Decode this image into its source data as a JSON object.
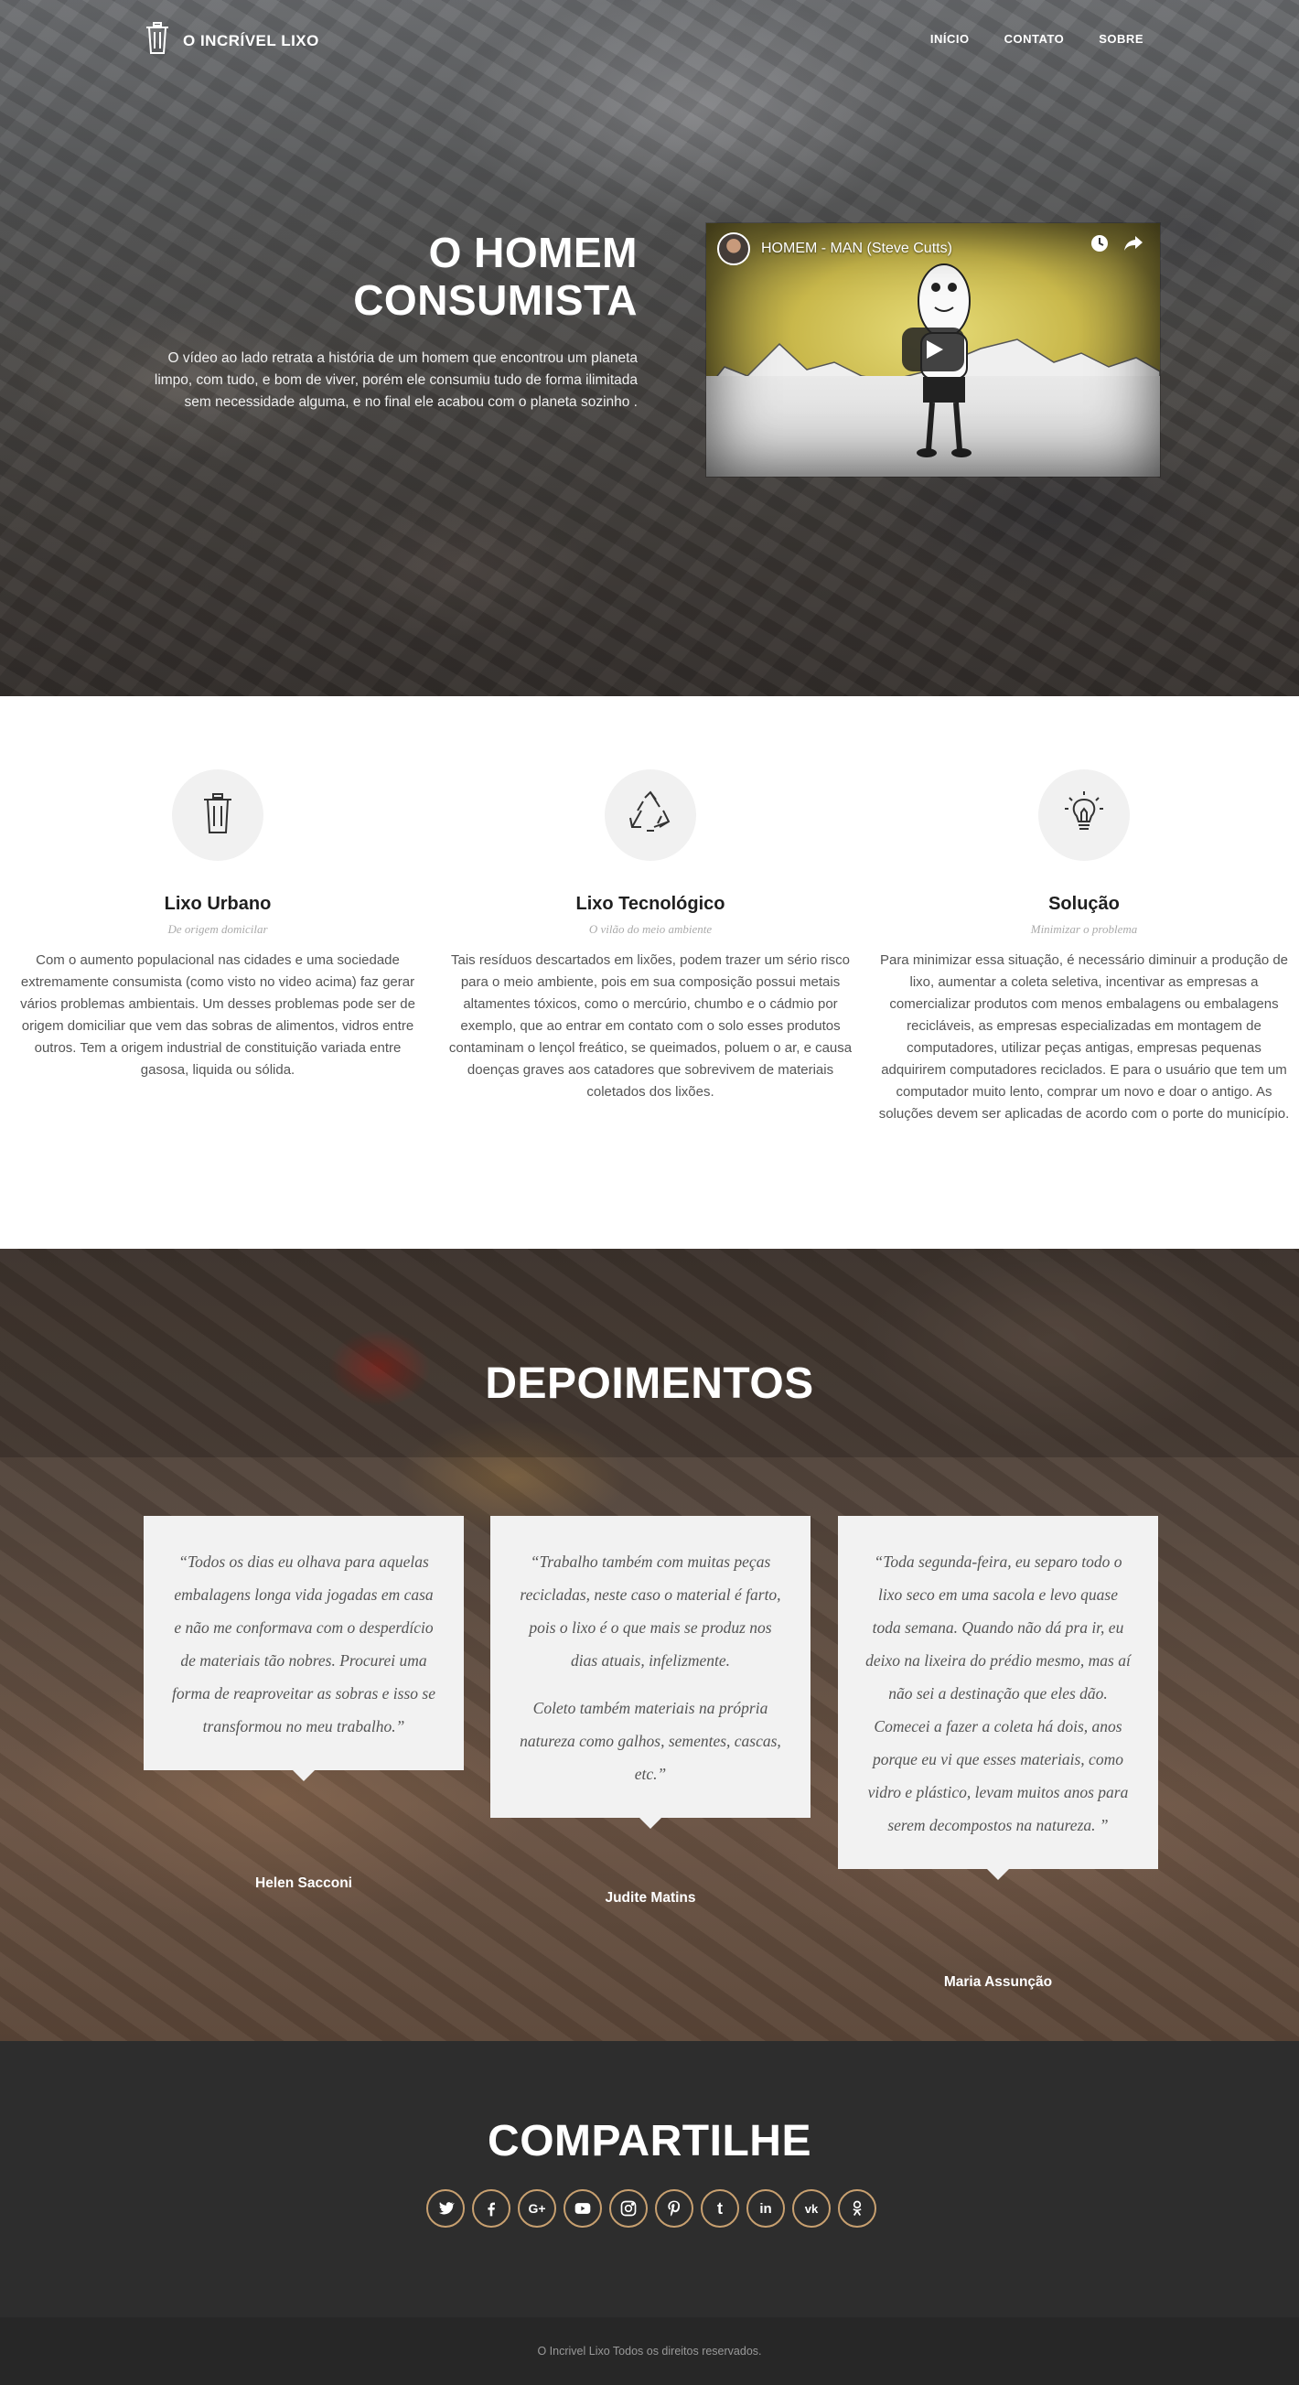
{
  "nav": {
    "brand": "O INCRÍVEL LIXO",
    "items": [
      {
        "label": "INÍCIO"
      },
      {
        "label": "CONTATO"
      },
      {
        "label": "SOBRE"
      }
    ]
  },
  "hero": {
    "title_line1": "O HOMEM",
    "title_line2": "CONSUMISTA",
    "description": "O vídeo ao lado retrata a história de um homem que encontrou um planeta limpo, com tudo, e bom de viver, porém ele consumiu tudo de forma ilimitada sem necessidade alguma, e no final ele acabou com o planeta sozinho .",
    "video": {
      "title": "HOMEM - MAN (Steve Cutts)",
      "icons": [
        "clock-icon",
        "share-icon",
        "play-icon"
      ]
    }
  },
  "features": [
    {
      "icon": "trash-icon",
      "title": "Lixo Urbano",
      "subtitle": "De origem domicilar",
      "text": "Com o aumento populacional nas cidades e uma sociedade extremamente consumista (como visto no video acima) faz gerar vários problemas ambientais. Um desses problemas pode ser de origem domiciliar que vem das sobras de alimentos, vidros entre outros. Tem a origem industrial de constituição variada entre gasosa, liquida ou sólida."
    },
    {
      "icon": "recycle-icon",
      "title": "Lixo Tecnológico",
      "subtitle": "O vilão do meio ambiente",
      "text": "Tais resíduos descartados em lixões, podem trazer um sério risco para o meio ambiente, pois em sua composição possui metais altamentes tóxicos, como o mercúrio, chumbo e o cádmio por exemplo, que ao entrar em contato com o solo esses produtos contaminam o lençol freático, se queimados, poluem o ar, e causa doenças graves aos catadores que sobrevivem de materiais coletados dos lixões."
    },
    {
      "icon": "lightbulb-icon",
      "title": "Solução",
      "subtitle": "Minimizar o problema",
      "text": "Para minimizar essa situação, é necessário diminuir a produção de lixo, aumentar a coleta seletiva, incentivar as empresas a comercializar produtos com menos embalagens ou embalagens recicláveis, as empresas especializadas em montagem de computadores, utilizar peças antigas, empresas pequenas adquirirem computadores reciclados. E para o usuário que tem um computador muito lento, comprar um novo e doar o antigo. As soluções devem ser aplicadas de acordo com o porte do município."
    }
  ],
  "testimonials": {
    "title": "DEPOIMENTOS",
    "items": [
      {
        "paragraphs": [
          "“Todos os dias eu olhava para aquelas embalagens longa vida jogadas em casa e não me conformava com o desperdício de materiais tão nobres. Procurei uma forma de reaproveitar as sobras e isso se transformou no meu trabalho.”"
        ],
        "name": "Helen Sacconi"
      },
      {
        "paragraphs": [
          "“Trabalho também com muitas peças recicladas, neste caso o material é farto, pois o lixo é o que mais se produz nos dias atuais, infelizmente.",
          "Coleto também materiais na própria natureza como galhos, sementes, cascas, etc.”"
        ],
        "name": "Judite Matins"
      },
      {
        "paragraphs": [
          "“Toda segunda-feira, eu separo todo o lixo seco em uma sacola e levo quase toda semana. Quando não dá pra ir, eu deixo na lixeira do prédio mesmo, mas aí não sei a destinação que eles dão. Comecei a fazer a coleta há dois, anos porque eu vi que esses materiais, como vidro e plástico, levam muitos anos para serem decompostos na natureza. ”"
        ],
        "name": "Maria  Assunção"
      }
    ]
  },
  "share": {
    "title": "COMPARTILHE",
    "networks": [
      {
        "name": "twitter-icon"
      },
      {
        "name": "facebook-icon"
      },
      {
        "name": "google-plus-icon",
        "label": "G+"
      },
      {
        "name": "youtube-icon"
      },
      {
        "name": "instagram-icon"
      },
      {
        "name": "pinterest-icon"
      },
      {
        "name": "tumblr-icon",
        "label": "t"
      },
      {
        "name": "linkedin-icon",
        "label": "in"
      },
      {
        "name": "vk-icon",
        "label": "vk"
      },
      {
        "name": "odnoklassniki-icon"
      }
    ],
    "border_color": "#c8a070"
  },
  "footer": {
    "text": "O Incrivel Lixo Todos os direitos reservados."
  }
}
